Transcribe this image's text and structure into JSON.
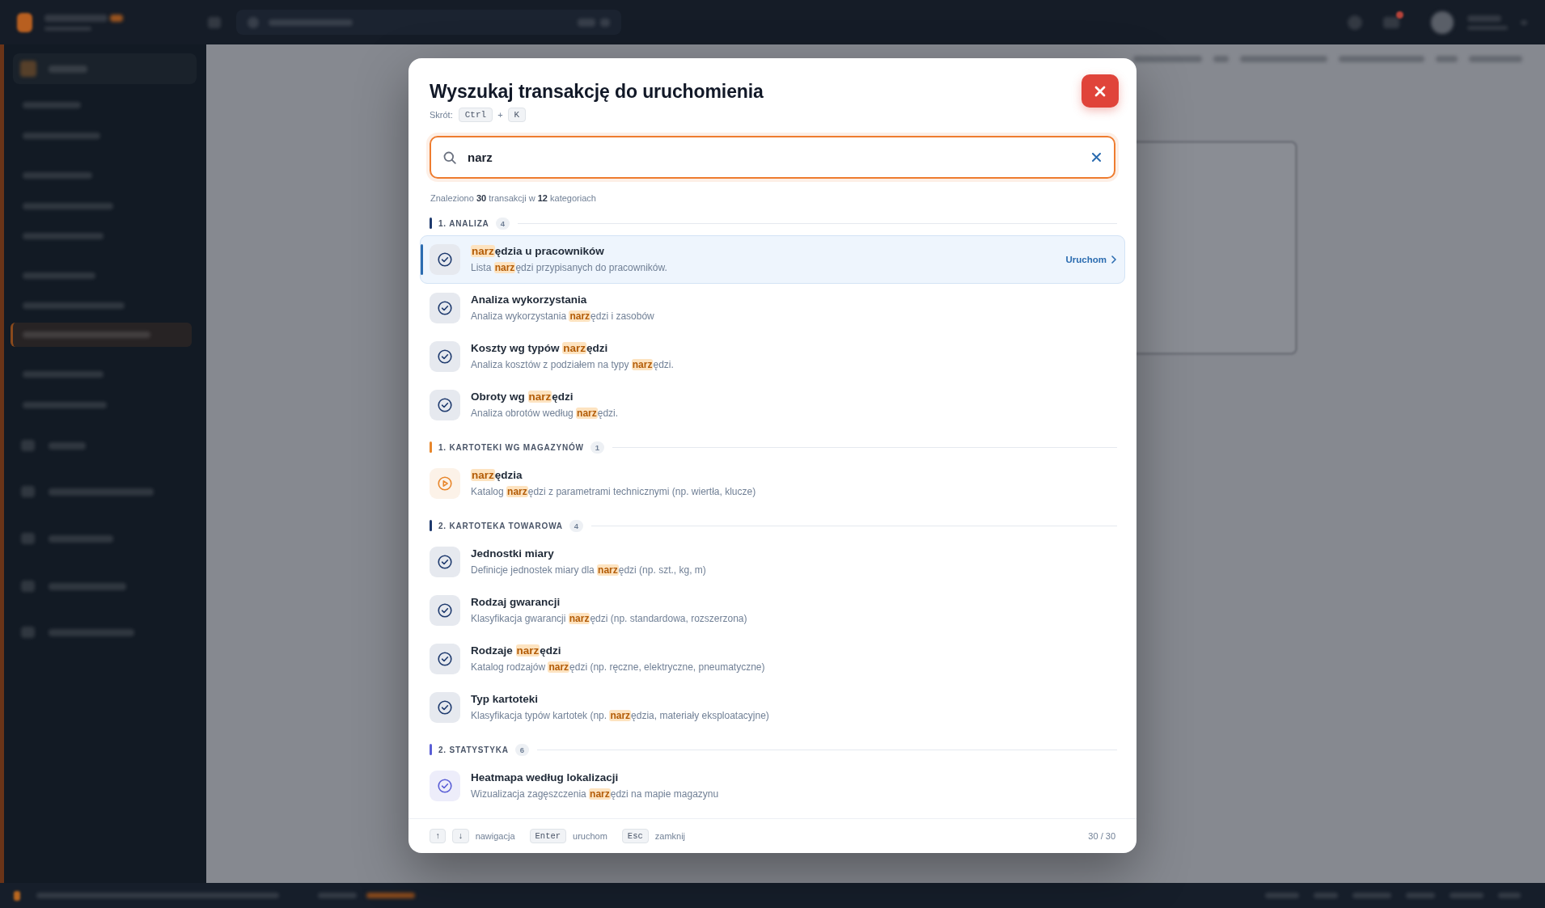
{
  "search_dialog": {
    "title": "Wyszukaj transakcję do uruchomienia",
    "shortcut": {
      "label": "Skrót:",
      "keys": [
        "Ctrl",
        "K"
      ],
      "separator": "+"
    },
    "search": {
      "value": "narz"
    },
    "summary": "Znaleziono **30** transakcji w **12** kategoriach",
    "run_label": "Uruchom",
    "categories": [
      {
        "title": "1. ANALIZA",
        "count": "4",
        "color": "#1e3a6e",
        "items": [
          {
            "kind": "check",
            "title": "**narz**ędzia u pracowników",
            "description": "Lista **narz**ędzi przypisanych do pracowników.",
            "selected": true
          },
          {
            "kind": "check",
            "title": "Analiza wykorzystania",
            "description": "Analiza wykorzystania **narz**ędzi i zasobów",
            "selected": false
          },
          {
            "kind": "check",
            "title": "Koszty wg typów **narz**ędzi",
            "description": "Analiza kosztów z podziałem na typy **narz**ędzi.",
            "selected": false
          },
          {
            "kind": "check",
            "title": "Obroty wg **narz**ędzi",
            "description": "Analiza obrotów według **narz**ędzi.",
            "selected": false
          }
        ]
      },
      {
        "title": "1. KARTOTEKI WG MAGAZYNÓW",
        "count": "1",
        "color": "#e8862b",
        "items": [
          {
            "kind": "play",
            "title": "**narz**ędzia",
            "description": "Katalog **narz**ędzi z parametrami technicznymi (np. wiertła, klucze)",
            "selected": false
          }
        ]
      },
      {
        "title": "2. KARTOTEKA TOWAROWA",
        "count": "4",
        "color": "#1e3a6e",
        "items": [
          {
            "kind": "check",
            "title": "Jednostki miary",
            "description": "Definicje jednostek miary dla **narz**ędzi (np. szt., kg, m)",
            "selected": false
          },
          {
            "kind": "check",
            "title": "Rodzaj gwarancji",
            "description": "Klasyfikacja gwarancji **narz**ędzi (np. standardowa, rozszerzona)",
            "selected": false
          },
          {
            "kind": "check",
            "title": "Rodzaje **narz**ędzi",
            "description": "Katalog rodzajów **narz**ędzi (np. ręczne, elektryczne, pneumatyczne)",
            "selected": false
          },
          {
            "kind": "check",
            "title": "Typ kartoteki",
            "description": "Klasyfikacja typów kartotek (np. **narz**ędzia, materiały eksploatacyjne)",
            "selected": false
          }
        ]
      },
      {
        "title": "2. STATYSTYKA",
        "count": "6",
        "color": "#5a5ed6",
        "items": [
          {
            "kind": "check",
            "title": "Heatmapa według lokalizacji",
            "description": "Wizualizacja zagęszczenia **narz**ędzi na mapie magazynu",
            "selected": false
          }
        ]
      }
    ],
    "footer": {
      "hints": [
        {
          "keys": [
            "↑",
            "↓"
          ],
          "label": "nawigacja"
        },
        {
          "keys": [
            "Enter"
          ],
          "label": "uruchom"
        },
        {
          "keys": [
            "Esc"
          ],
          "label": "zamknij"
        }
      ],
      "counter": "30 / 30"
    }
  }
}
